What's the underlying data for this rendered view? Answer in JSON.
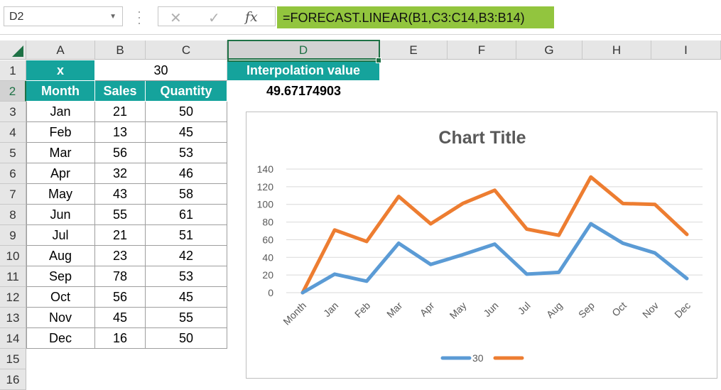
{
  "formula_bar": {
    "name_box": "D2",
    "cancel_icon": "✕",
    "enter_icon": "✓",
    "fx_label": "fx",
    "formula": "=FORECAST.LINEAR(B1,C3:C14,B3:B14)"
  },
  "columns": [
    "A",
    "B",
    "C",
    "D",
    "E",
    "F",
    "G",
    "H",
    "I"
  ],
  "rows": [
    "1",
    "2",
    "3",
    "4",
    "5",
    "6",
    "7",
    "8",
    "9",
    "10",
    "11",
    "12",
    "13",
    "14",
    "15",
    "16"
  ],
  "sheet": {
    "a1": "x",
    "b1": "30",
    "d1": "Interpolation value",
    "d2": "49.67174903",
    "headers": [
      "Month",
      "Sales",
      "Quantity"
    ],
    "data": [
      [
        "Jan",
        "21",
        "50"
      ],
      [
        "Feb",
        "13",
        "45"
      ],
      [
        "Mar",
        "56",
        "53"
      ],
      [
        "Apr",
        "32",
        "46"
      ],
      [
        "May",
        "43",
        "58"
      ],
      [
        "Jun",
        "55",
        "61"
      ],
      [
        "Jul",
        "21",
        "51"
      ],
      [
        "Aug",
        "23",
        "42"
      ],
      [
        "Sep",
        "78",
        "53"
      ],
      [
        "Oct",
        "56",
        "45"
      ],
      [
        "Nov",
        "45",
        "55"
      ],
      [
        "Dec",
        "16",
        "50"
      ]
    ]
  },
  "colors": {
    "teal": "#15a39c",
    "selection": "#1e7145",
    "formula_bg": "#92c53e",
    "series_blue": "#5b9bd5",
    "series_orange": "#ed7d31"
  },
  "chart_data": {
    "type": "line",
    "title": "Chart Title",
    "categories": [
      "Month",
      "Jan",
      "Feb",
      "Mar",
      "Apr",
      "May",
      "Jun",
      "Jul",
      "Aug",
      "Sep",
      "Oct",
      "Nov",
      "Dec"
    ],
    "series": [
      {
        "name": "30",
        "values": [
          0,
          21,
          13,
          56,
          32,
          43,
          55,
          21,
          23,
          78,
          56,
          45,
          16
        ],
        "color": "#5b9bd5"
      },
      {
        "name": "",
        "values": [
          0,
          71,
          58,
          109,
          78,
          101,
          116,
          72,
          65,
          131,
          101,
          100,
          66
        ],
        "color": "#ed7d31"
      }
    ],
    "ylim": [
      0,
      140
    ],
    "yticks": [
      0,
      20,
      40,
      60,
      80,
      100,
      120,
      140
    ],
    "grid": true,
    "legend": "bottom"
  }
}
